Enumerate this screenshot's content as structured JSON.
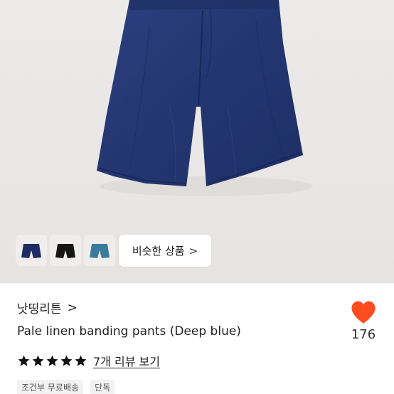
{
  "thumbnails": [
    {
      "name": "navy-shorts",
      "color": "#1f2c63"
    },
    {
      "name": "black-shorts",
      "color": "#151515"
    },
    {
      "name": "teal-shorts",
      "color": "#3a7a9c"
    }
  ],
  "similar_button": {
    "label": "비슷한 상품",
    "chevron": ">"
  },
  "shop": {
    "name": "낫띵리튼",
    "chevron": ">"
  },
  "product": {
    "title": "Pale linen banding pants (Deep blue)"
  },
  "rating": {
    "stars": 5,
    "review_link": "7개 리뷰 보기"
  },
  "tags": [
    "조건부 무료배송",
    "단독"
  ],
  "like": {
    "count": "176",
    "icon": "heart-icon",
    "color": "#ff4d1f"
  },
  "colors": {
    "product": "#273a78",
    "star": "#111111"
  }
}
